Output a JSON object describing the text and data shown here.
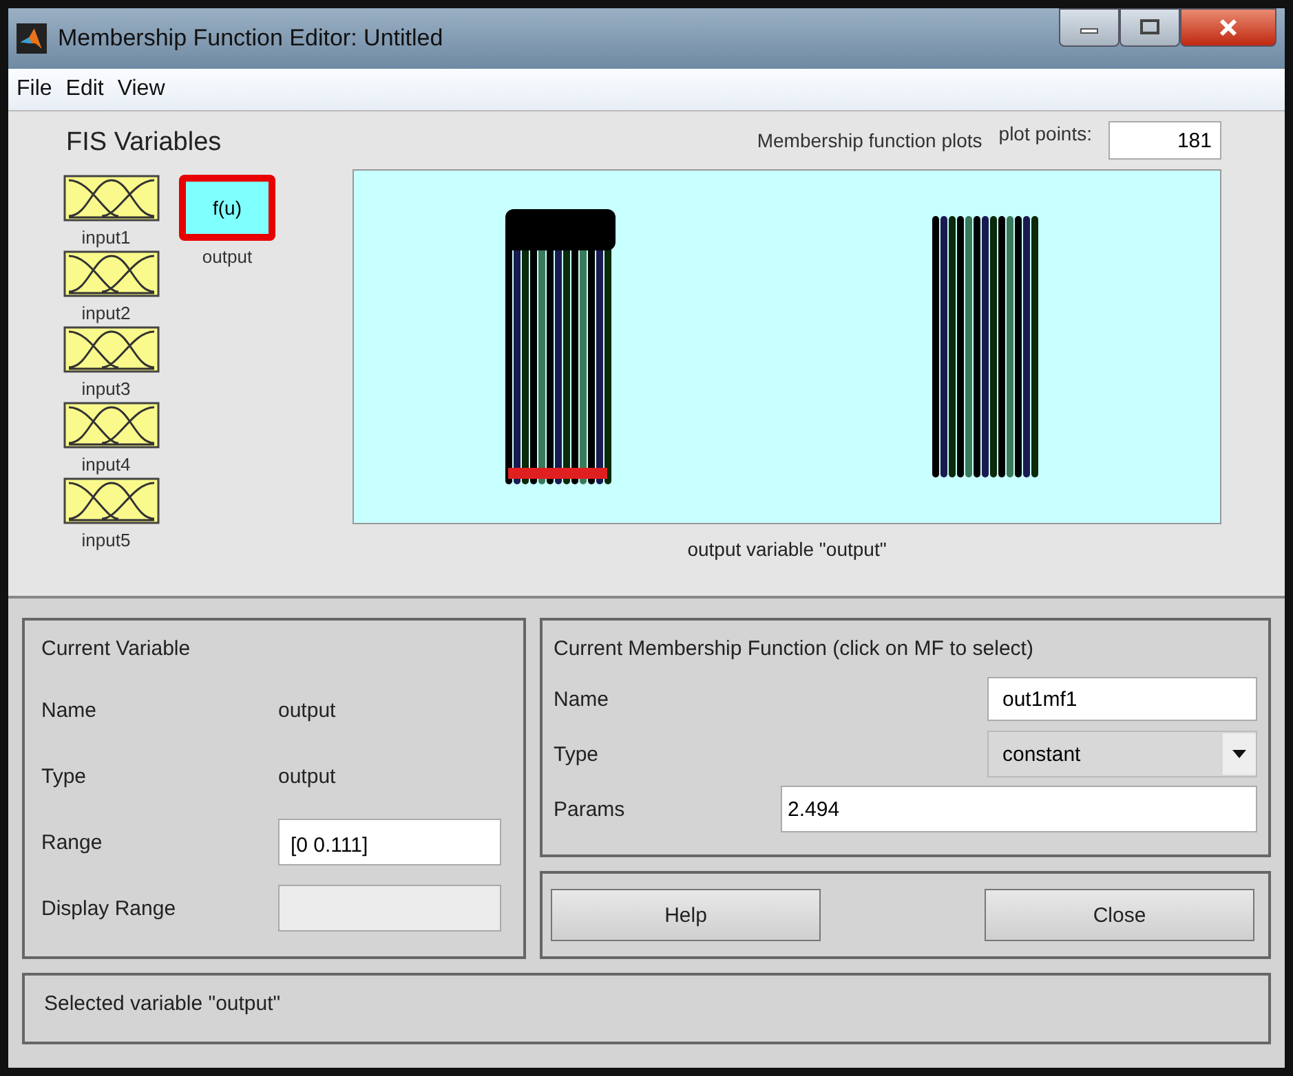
{
  "window": {
    "title": "Membership Function Editor: Untitled"
  },
  "menu": [
    "File",
    "Edit",
    "View"
  ],
  "fis_variables": {
    "title": "FIS Variables",
    "inputs": [
      {
        "label": "input1",
        "selected": false
      },
      {
        "label": "input2",
        "selected": false
      },
      {
        "label": "input3",
        "selected": false
      },
      {
        "label": "input4",
        "selected": false
      },
      {
        "label": "input5",
        "selected": false
      }
    ],
    "output": {
      "symbol": "f(u)",
      "label": "output",
      "selected": true
    }
  },
  "plot": {
    "title": "Membership function plots",
    "plot_points_label": "plot points:",
    "plot_points": "181",
    "caption": "output variable \"output\""
  },
  "current_variable": {
    "title": "Current Variable",
    "fields": [
      {
        "label": "Name",
        "kind": "text",
        "value": "output"
      },
      {
        "label": "Type",
        "kind": "text",
        "value": "output"
      },
      {
        "label": "Range",
        "kind": "input",
        "value": "[0 0.111]",
        "disabled": false
      },
      {
        "label": "Display Range",
        "kind": "input",
        "disabled": true
      }
    ]
  },
  "current_mf": {
    "title": "Current Membership Function (click on MF to select)",
    "name": "out1mf1",
    "type": "constant",
    "params": "2.494",
    "labels": {
      "name": "Name",
      "type": "Type",
      "params": "Params"
    }
  },
  "buttons": [
    "Help",
    "Close"
  ],
  "status": "Selected variable \"output\""
}
